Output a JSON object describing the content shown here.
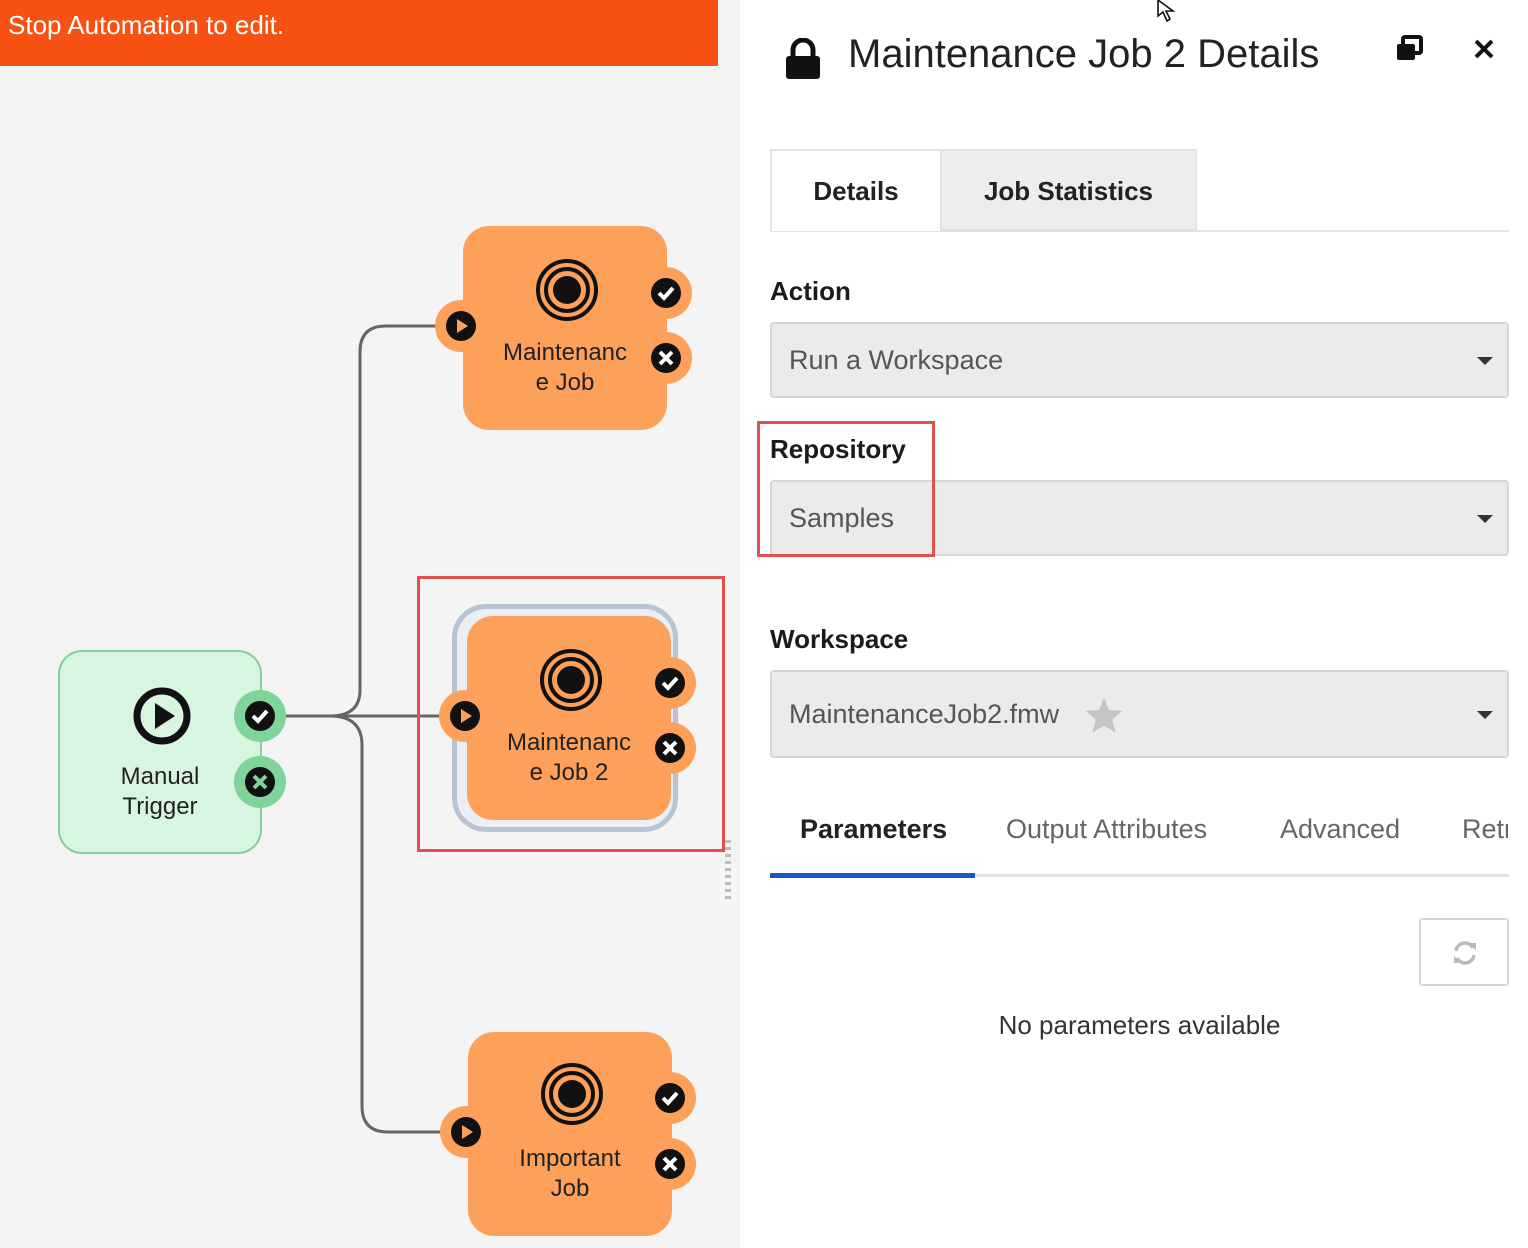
{
  "banner": {
    "text": "Stop Automation to edit."
  },
  "canvas": {
    "trigger": {
      "label": "Manual\nTrigger",
      "icon": "play-circle-icon"
    },
    "nodes": [
      {
        "label": "Maintenanc\ne  Job",
        "icon": "target-icon"
      },
      {
        "label": "Maintenanc\ne  Job 2",
        "icon": "target-icon"
      },
      {
        "label": "Important\nJob",
        "icon": "target-icon"
      }
    ],
    "colors": {
      "job": "#fda05a",
      "trigger": "#d8f5e0",
      "port_success": "#7fd49a",
      "highlight": "#e0504d"
    }
  },
  "panel": {
    "title": "Maintenance Job 2 Details",
    "tabs": [
      "Details",
      "Job Statistics"
    ],
    "action": {
      "label": "Action",
      "value": "Run a Workspace"
    },
    "repository": {
      "label": "Repository",
      "value": "Samples"
    },
    "workspace": {
      "label": "Workspace",
      "value": "MaintenanceJob2.fmw"
    },
    "subtabs": [
      "Parameters",
      "Output Attributes",
      "Advanced",
      "Retr"
    ],
    "empty_message": "No parameters available",
    "accent": "#1a56c8"
  }
}
